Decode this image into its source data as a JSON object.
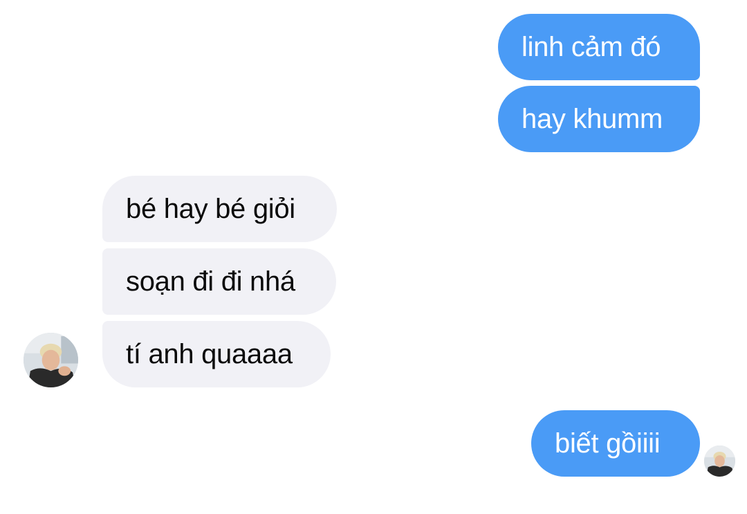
{
  "conversation": {
    "messages": [
      {
        "sender": "me",
        "text": "linh cảm đó"
      },
      {
        "sender": "me",
        "text": "hay khumm"
      },
      {
        "sender": "other",
        "text": "bé hay bé giỏi"
      },
      {
        "sender": "other",
        "text": "soạn đi đi nhá"
      },
      {
        "sender": "other",
        "text": "tí anh quaaaa"
      },
      {
        "sender": "me",
        "text": "biết gồiiii"
      }
    ]
  },
  "colors": {
    "outgoing_bubble": "#4a9bf6",
    "incoming_bubble": "#f1f1f6",
    "outgoing_text": "#ffffff",
    "incoming_text": "#0a0a0a"
  },
  "avatars": {
    "contact": "contact-avatar-photo",
    "seen_receipt": "seen-receipt-avatar-photo"
  }
}
